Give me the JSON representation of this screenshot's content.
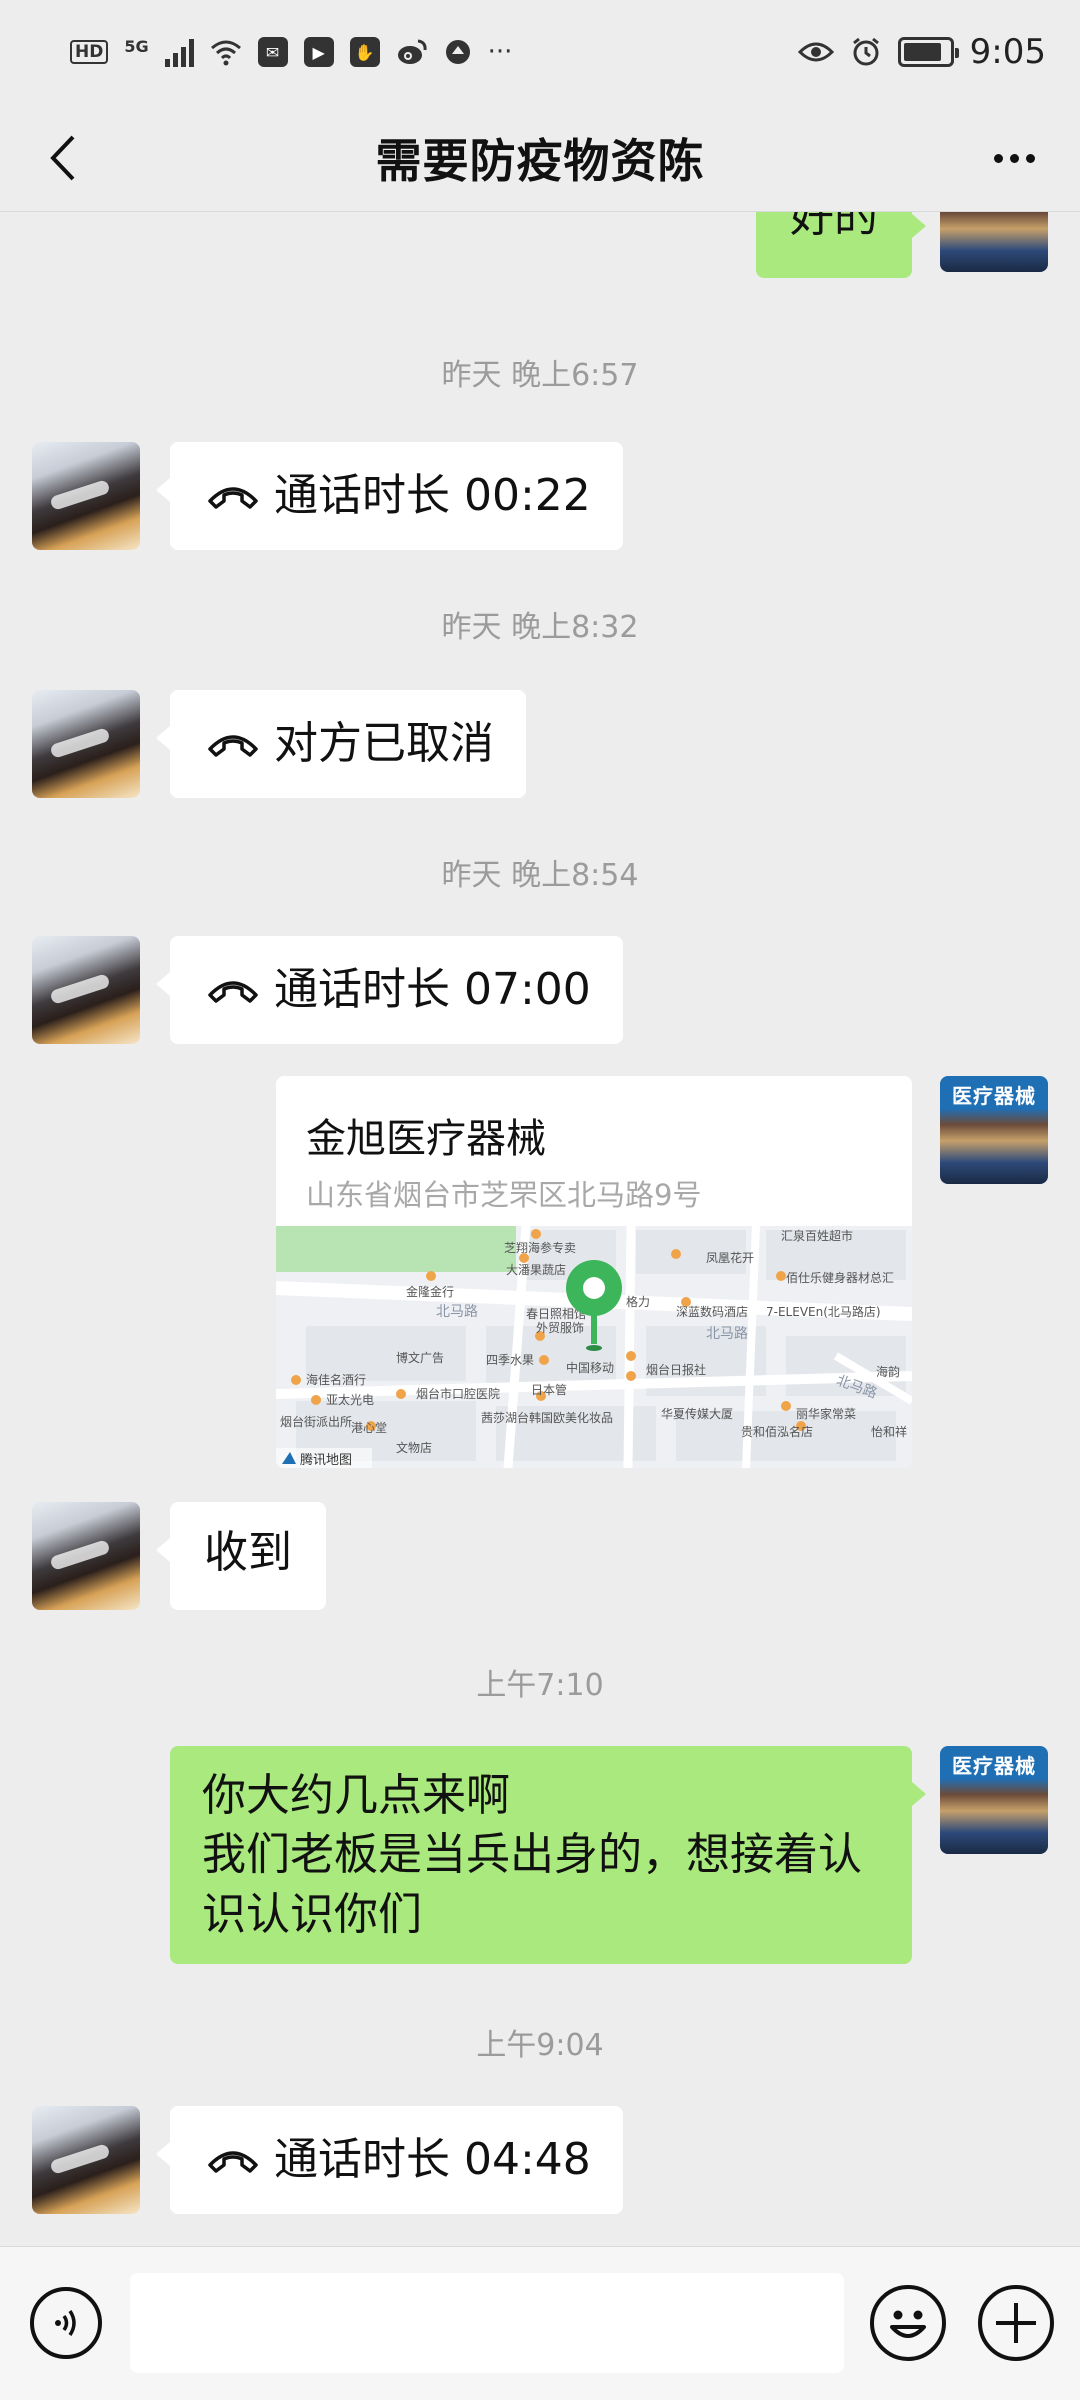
{
  "status_bar": {
    "hd": "HD",
    "network": "5G",
    "icons": [
      "signal-icon",
      "wifi-icon",
      "app-icon",
      "app-icon",
      "app-icon",
      "weibo-icon",
      "app-icon"
    ],
    "more": "···",
    "time": "9:05"
  },
  "header": {
    "title": "需要防疫物资陈"
  },
  "messages": [
    {
      "type": "text",
      "side": "right",
      "text": "好的"
    },
    {
      "type": "timestamp",
      "text": "昨天 晚上6:57"
    },
    {
      "type": "call",
      "side": "left",
      "text": "通话时长 00:22"
    },
    {
      "type": "timestamp",
      "text": "昨天 晚上8:32"
    },
    {
      "type": "call",
      "side": "left",
      "text": "对方已取消"
    },
    {
      "type": "timestamp",
      "text": "昨天 晚上8:54"
    },
    {
      "type": "call",
      "side": "left",
      "text": "通话时长 07:00"
    },
    {
      "type": "location",
      "side": "right",
      "title": "金旭医疗器械",
      "address": "山东省烟台市芝罘区北马路9号"
    },
    {
      "type": "text",
      "side": "left",
      "text": "收到"
    },
    {
      "type": "timestamp",
      "text": "上午7:10"
    },
    {
      "type": "text",
      "side": "right",
      "text": "你大约几点来啊\n我们老板是当兵出身的，想接着认识认识你们"
    },
    {
      "type": "timestamp",
      "text": "上午9:04"
    },
    {
      "type": "call",
      "side": "left",
      "text": "通话时长 04:48"
    }
  ],
  "right_avatar_text": "医疗器械",
  "map": {
    "roads": [
      "北马路",
      "北马路",
      "北马路",
      "北马路"
    ],
    "pois": [
      "芝翔海参专卖",
      "金隆金行",
      "大潘果蔬店",
      "凤凰花开",
      "汇泉百姓超市",
      "佰仕乐健身器材总汇",
      "格力",
      "深蓝数码酒店",
      "7-ELEVEn(北马路店)",
      "春日照相馆",
      "外贸服饰",
      "博文广告",
      "四季水果",
      "中国移动",
      "烟台日报社",
      "海佳名酒行",
      "亚太光电",
      "烟台市口腔医院",
      "日本管",
      "海韵",
      "华夏传媒大厦",
      "丽华家常菜",
      "怡和祥",
      "港心堂",
      "文物店",
      "茜莎湖台韩国欧美化妆品",
      "贵和佰泓名店",
      "烟台街派出所"
    ],
    "credit": "腾讯地图"
  },
  "input": {
    "value": "",
    "placeholder": ""
  },
  "colors": {
    "background": "#ededed",
    "bubble_green": "#a9e97d",
    "bubble_white": "#ffffff",
    "timestamp": "#9b9b9b",
    "map_pin": "#3cb55b"
  }
}
